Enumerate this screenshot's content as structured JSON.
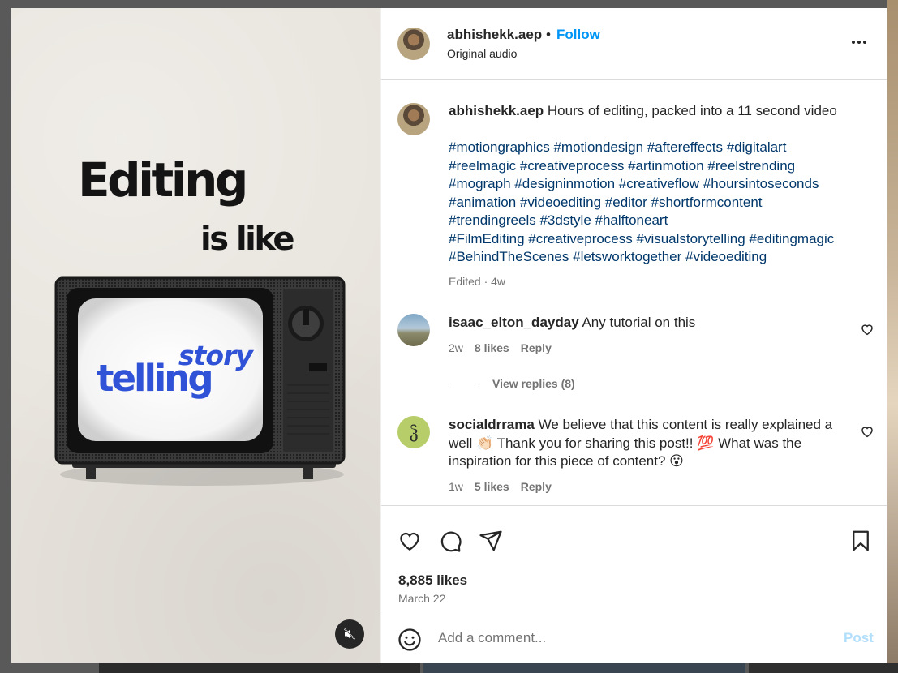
{
  "post": {
    "username": "abhishekk.aep",
    "follow_label": "Follow",
    "dot": "•",
    "audio": "Original audio"
  },
  "media": {
    "headline_line1": "Editing",
    "headline_line2": "is like",
    "screen_word1": "story",
    "screen_word2": "telling",
    "mute_icon": "speaker-muted-icon"
  },
  "caption": {
    "username": "abhishekk.aep",
    "text": "Hours of editing, packed into a 11 second video",
    "hashtag_lines": [
      "#motiongraphics #motiondesign #aftereffects #digitalart",
      "#reelmagic #creativeprocess #artinmotion #reelstrending",
      "#mograph #designinmotion #creativeflow #hoursintoseconds",
      "#animation #videoediting #editor #shortformcontent",
      "#trendingreels #3dstyle #halftoneart",
      "#FilmEditing #creativeprocess #visualstorytelling #editingmagic",
      "#BehindTheScenes #letsworktogether #videoediting"
    ],
    "meta": "Edited · 4w"
  },
  "comments": [
    {
      "username": "isaac_elton_dayday",
      "text": "Any tutorial on this",
      "age": "2w",
      "likes": "8 likes",
      "reply_label": "Reply"
    },
    {
      "username": "socialdrrama",
      "text": "We believe that this content is really explained a well 👏🏻 Thank you for sharing this post!! 💯 What was the inspiration for this piece of content? 😮",
      "avatar_letter": "ჴ",
      "age": "1w",
      "likes": "5 likes",
      "reply_label": "Reply"
    }
  ],
  "view_replies": "View replies (8)",
  "likes_count": "8,885 likes",
  "post_date": "March 22",
  "add_comment": {
    "placeholder": "Add a comment...",
    "post_label": "Post"
  },
  "colors": {
    "link_blue": "#0095f6",
    "hashtag_blue": "#00376b",
    "post_disabled": "#b2dffc",
    "screen_text_blue": "#2f52d6"
  }
}
